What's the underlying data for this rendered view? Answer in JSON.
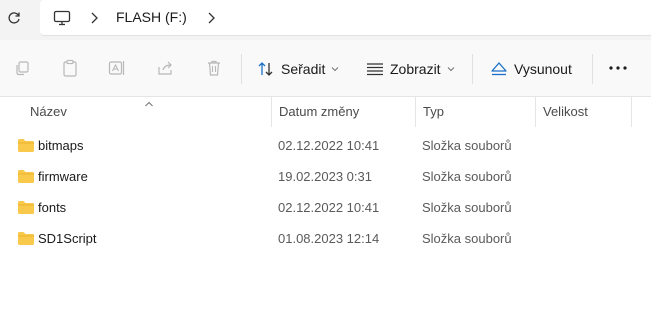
{
  "address": {
    "breadcrumb": "FLASH (F:)"
  },
  "toolbar": {
    "sort_label": "Seřadit",
    "view_label": "Zobrazit",
    "eject_label": "Vysunout"
  },
  "columns": {
    "name": "Název",
    "date": "Datum změny",
    "type": "Typ",
    "size": "Velikost"
  },
  "files": [
    {
      "name": "bitmaps",
      "date": "02.12.2022 10:41",
      "type": "Složka souborů",
      "size": ""
    },
    {
      "name": "firmware",
      "date": "19.02.2023 0:31",
      "type": "Složka souborů",
      "size": ""
    },
    {
      "name": "fonts",
      "date": "02.12.2022 10:41",
      "type": "Složka souborů",
      "size": ""
    },
    {
      "name": "SD1Script",
      "date": "01.08.2023 12:14",
      "type": "Složka souborů",
      "size": ""
    }
  ],
  "colors": {
    "folder": "#f8c94a",
    "accent": "#1a6fc9"
  },
  "icons": [
    "refresh-icon",
    "computer-icon",
    "chevron-right-icon",
    "copy-icon",
    "paste-icon",
    "rename-icon",
    "share-icon",
    "delete-icon",
    "sort-icon",
    "view-icon",
    "eject-icon",
    "more-icon",
    "folder-icon"
  ]
}
